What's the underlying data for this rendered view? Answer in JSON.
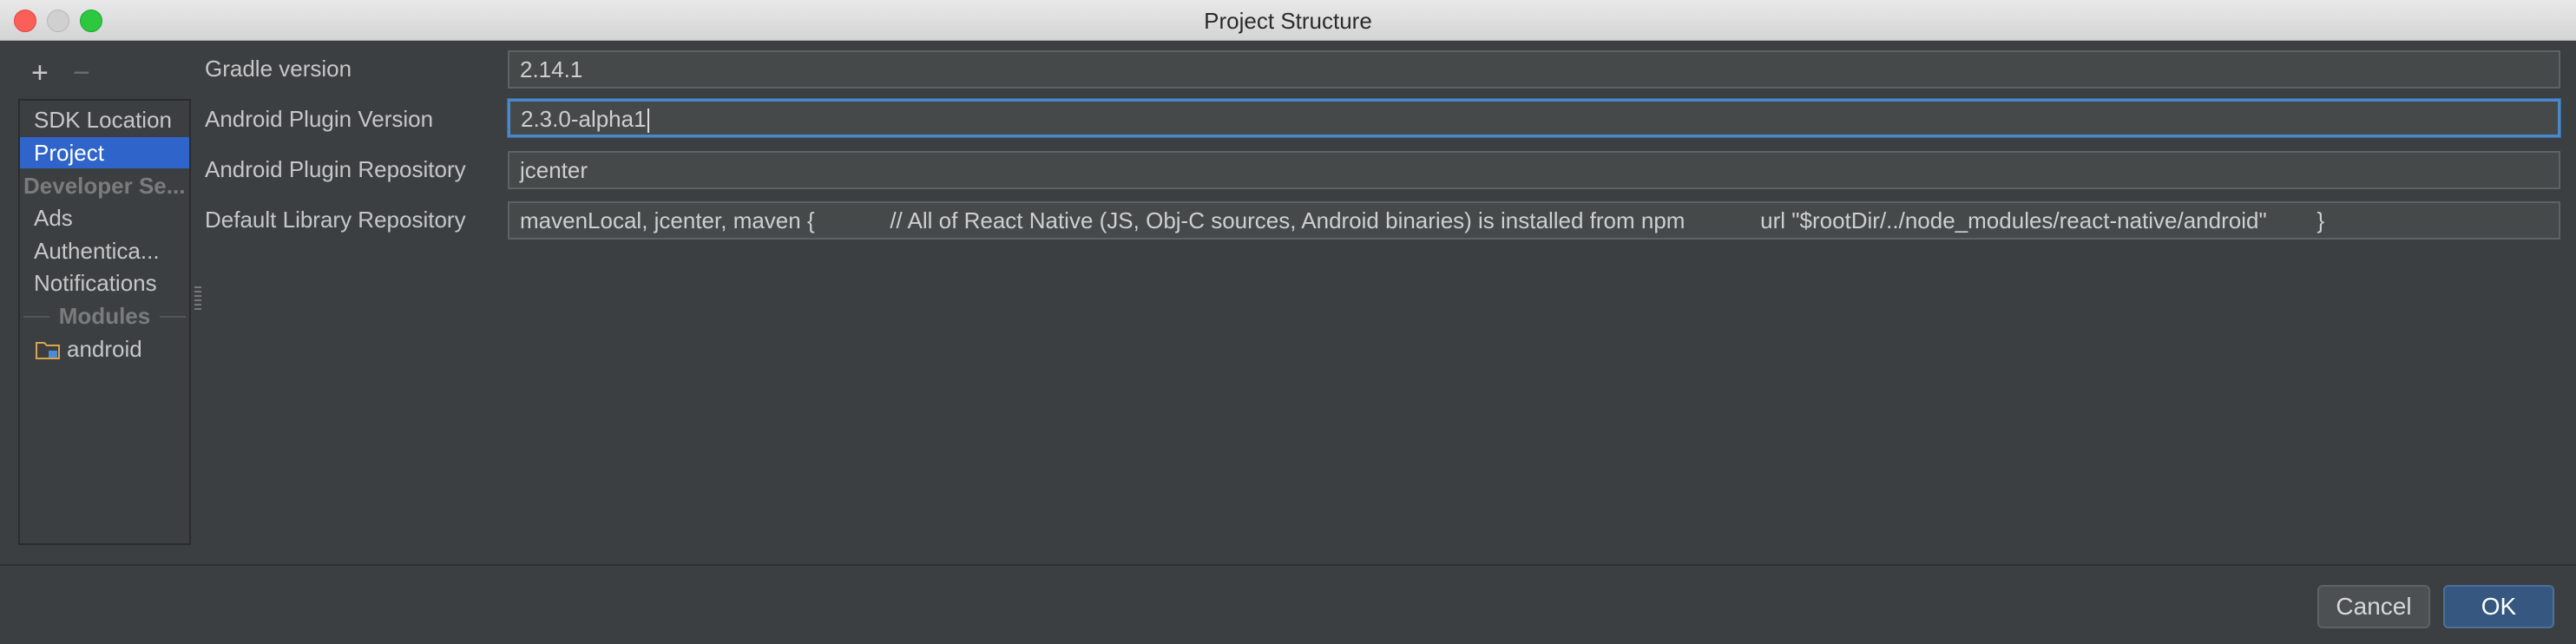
{
  "window": {
    "title": "Project Structure"
  },
  "toolbar": {
    "add": "+",
    "remove": "−"
  },
  "sidebar": {
    "items": [
      {
        "label": "SDK Location"
      },
      {
        "label": "Project"
      },
      {
        "label": "Ads"
      },
      {
        "label": "Authentica..."
      },
      {
        "label": "Notifications"
      },
      {
        "label": "android"
      }
    ],
    "sections": {
      "developer": "Developer Se...",
      "modules": "Modules"
    },
    "selected": "Project"
  },
  "form": {
    "gradle_version": {
      "label": "Gradle version",
      "value": "2.14.1"
    },
    "plugin_version": {
      "label": "Android Plugin Version",
      "value": "2.3.0-alpha1"
    },
    "plugin_repository": {
      "label": "Android Plugin Repository",
      "value": "jcenter"
    },
    "library_repository": {
      "label": "Default Library Repository",
      "value": "mavenLocal, jcenter, maven {            // All of React Native (JS, Obj-C sources, Android binaries) is installed from npm            url \"$rootDir/../node_modules/react-native/android\"        }"
    }
  },
  "buttons": {
    "cancel": "Cancel",
    "ok": "OK"
  },
  "colors": {
    "selection": "#2f65ca",
    "focus": "#4a88c7",
    "ok_button": "#365880"
  }
}
